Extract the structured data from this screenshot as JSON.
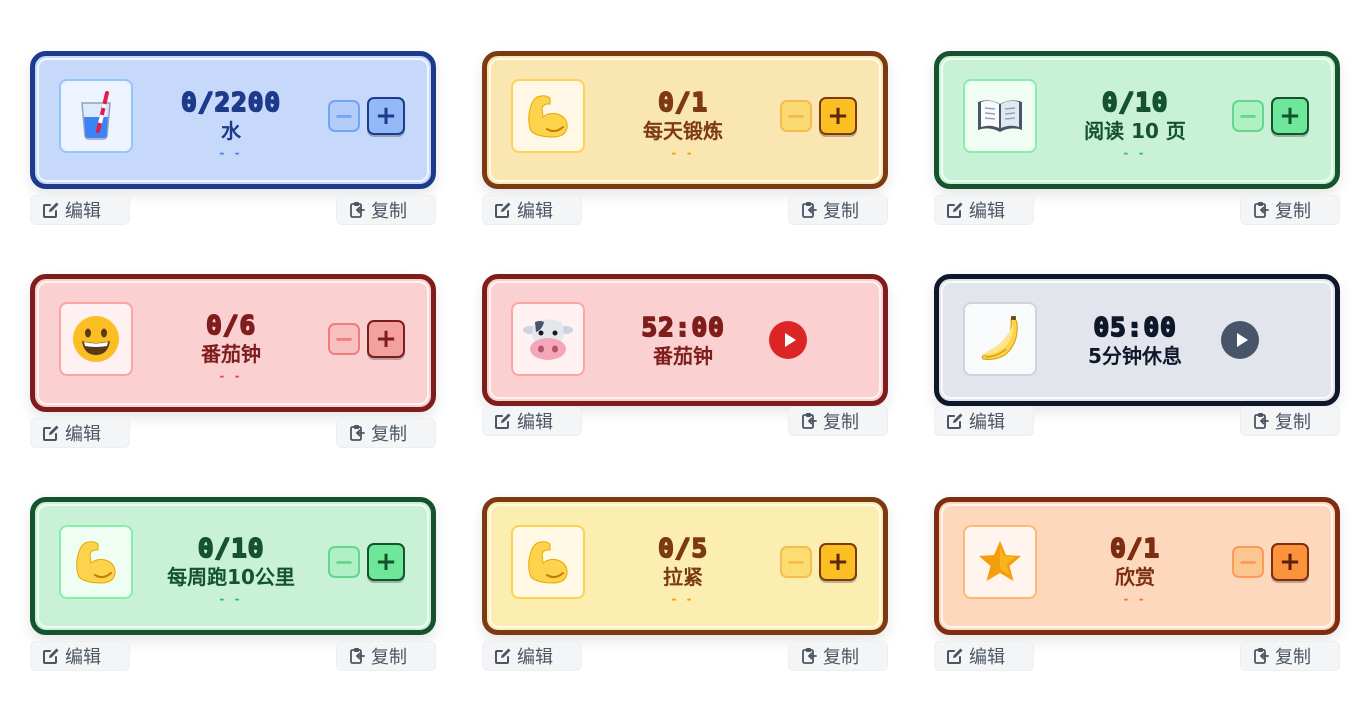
{
  "cards": [
    {
      "count": "0/2200",
      "name": "水",
      "dash": "- -",
      "icon": "water-glass-icon",
      "kind": "counter",
      "colors": {
        "bg": "#c7d9fb",
        "border": "#1e3a8a",
        "text": "#1e3a8a",
        "accent": "#3b82f6",
        "iconbg": "#eef4ff",
        "iconborder": "#93c5fd",
        "plusbg": "#93b9f7",
        "plustext": "#1e3a8a",
        "minusbg": "#a8c5f8"
      }
    },
    {
      "count": "0/1",
      "name": "每天锻炼",
      "dash": "- -",
      "icon": "flexed-biceps-icon",
      "kind": "counter",
      "colors": {
        "bg": "#fae6b0",
        "border": "#7c3a12",
        "text": "#7c3a12",
        "accent": "#f59e0b",
        "iconbg": "#fff8e6",
        "iconborder": "#fcd34d",
        "plusbg": "#fbbf24",
        "plustext": "#5c2a0a",
        "minusbg": "#fcd34d"
      }
    },
    {
      "count": "0/10",
      "name": "阅读 10 页",
      "dash": "- -",
      "icon": "open-book-icon",
      "kind": "counter",
      "colors": {
        "bg": "#c8f1d6",
        "border": "#14532d",
        "text": "#14532d",
        "accent": "#22c55e",
        "iconbg": "#effdf3",
        "iconborder": "#86efac",
        "plusbg": "#6ee79a",
        "plustext": "#14532d",
        "minusbg": "#9ff0bb"
      }
    },
    {
      "count": "0/6",
      "name": "番茄钟",
      "dash": "- -",
      "icon": "grinning-face-icon",
      "kind": "counter",
      "colors": {
        "bg": "#fbd0d0",
        "border": "#7f1d1d",
        "text": "#7f1d1d",
        "accent": "#ef4444",
        "iconbg": "#fff1f1",
        "iconborder": "#fca5a5",
        "plusbg": "#f3a0a0",
        "plustext": "#7f1d1d",
        "minusbg": "#f8b6b6"
      }
    },
    {
      "count": "52:00",
      "name": "番茄钟",
      "dash": "",
      "icon": "cow-face-icon",
      "kind": "timer",
      "colors": {
        "bg": "#fbd0d0",
        "border": "#7f1d1d",
        "text": "#7f1d1d",
        "accent": "#dc2626",
        "iconbg": "#fff1f1",
        "iconborder": "#fca5a5",
        "plusbg": "",
        "plustext": "",
        "minusbg": ""
      }
    },
    {
      "count": "05:00",
      "name": "5分钟休息",
      "dash": "",
      "icon": "banana-icon",
      "kind": "timer",
      "colors": {
        "bg": "#e2e6ec",
        "border": "#0f172a",
        "text": "#0f172a",
        "accent": "#475569",
        "iconbg": "#f8fafc",
        "iconborder": "#cbd5e1",
        "plusbg": "",
        "plustext": "",
        "minusbg": ""
      }
    },
    {
      "count": "0/10",
      "name": "每周跑10公里",
      "dash": "- -",
      "icon": "flexed-biceps-icon",
      "kind": "counter",
      "colors": {
        "bg": "#c8f1d6",
        "border": "#14532d",
        "text": "#14532d",
        "accent": "#22c55e",
        "iconbg": "#effdf3",
        "iconborder": "#86efac",
        "plusbg": "#6ee79a",
        "plustext": "#14532d",
        "minusbg": "#9ff0bb"
      }
    },
    {
      "count": "0/5",
      "name": "拉紧",
      "dash": "- -",
      "icon": "flexed-biceps-icon",
      "kind": "counter",
      "colors": {
        "bg": "#fbeeb0",
        "border": "#7c3a12",
        "text": "#7c3a12",
        "accent": "#f59e0b",
        "iconbg": "#fff9e6",
        "iconborder": "#fcd34d",
        "plusbg": "#fbbf24",
        "plustext": "#5c2a0a",
        "minusbg": "#fcd34d"
      }
    },
    {
      "count": "0/1",
      "name": "欣赏",
      "dash": "- -",
      "icon": "star-icon",
      "kind": "counter",
      "colors": {
        "bg": "#fdd8bc",
        "border": "#7c2d12",
        "text": "#7c2d12",
        "accent": "#f97316",
        "iconbg": "#fff5ee",
        "iconborder": "#fdba74",
        "plusbg": "#fb923c",
        "plustext": "#5c1f0a",
        "minusbg": "#fdba74"
      }
    }
  ],
  "actions": {
    "edit_label": "编辑",
    "copy_label": "复制",
    "edit_icon": "edit-icon",
    "copy_icon": "copy-icon"
  }
}
